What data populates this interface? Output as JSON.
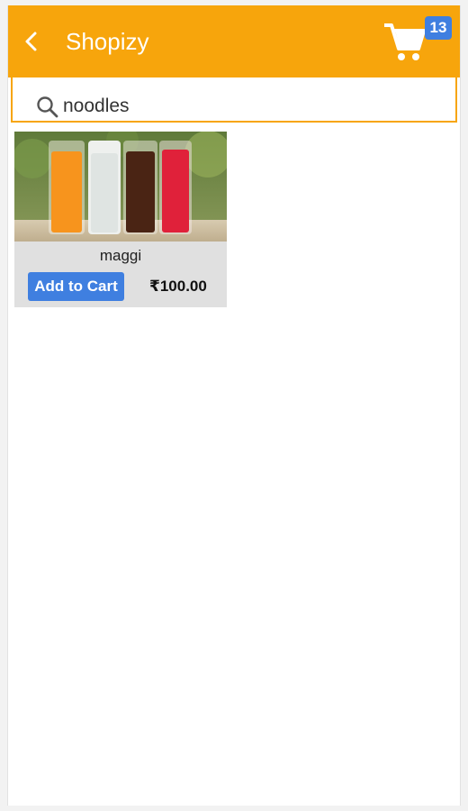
{
  "appbar": {
    "title": "Shopizy",
    "back_icon": "chevron-left-icon",
    "cart_icon": "shopping-cart-icon",
    "cart_count": "13",
    "background_color": "#f7a50c"
  },
  "search": {
    "icon": "search-icon",
    "value": "noodles"
  },
  "products": [
    {
      "name": "maggi",
      "image": "drinks-photo",
      "add_label": "Add to Cart",
      "price": "₹100.00"
    }
  ],
  "colors": {
    "accent": "#3f7fe0",
    "card_bg": "#e0e0e0"
  }
}
